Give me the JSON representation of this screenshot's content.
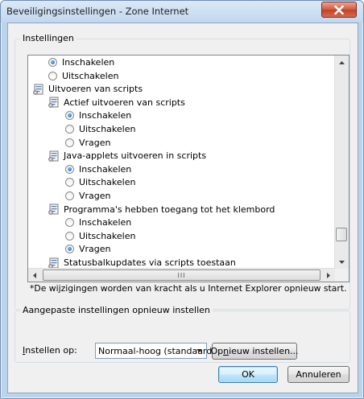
{
  "window": {
    "title": "Beveiligingsinstellingen - Zone Internet"
  },
  "settings_group": {
    "label": "Instellingen"
  },
  "settings_list": {
    "rows": [
      {
        "kind": "radio",
        "level": 1,
        "checked": true,
        "label": "Inschakelen"
      },
      {
        "kind": "radio",
        "level": 1,
        "checked": false,
        "label": "Uitschakelen"
      },
      {
        "kind": "header",
        "level": 0,
        "label": "Uitvoeren van scripts"
      },
      {
        "kind": "header",
        "level": 1,
        "label": "Actief uitvoeren van scripts"
      },
      {
        "kind": "radio",
        "level": 2,
        "checked": true,
        "label": "Inschakelen"
      },
      {
        "kind": "radio",
        "level": 2,
        "checked": false,
        "label": "Uitschakelen"
      },
      {
        "kind": "radio",
        "level": 2,
        "checked": false,
        "label": "Vragen"
      },
      {
        "kind": "header",
        "level": 1,
        "label": "Java-applets uitvoeren in scripts"
      },
      {
        "kind": "radio",
        "level": 2,
        "checked": true,
        "label": "Inschakelen"
      },
      {
        "kind": "radio",
        "level": 2,
        "checked": false,
        "label": "Uitschakelen"
      },
      {
        "kind": "radio",
        "level": 2,
        "checked": false,
        "label": "Vragen"
      },
      {
        "kind": "header",
        "level": 1,
        "label": "Programma's hebben toegang tot het klembord"
      },
      {
        "kind": "radio",
        "level": 2,
        "checked": false,
        "label": "Inschakelen"
      },
      {
        "kind": "radio",
        "level": 2,
        "checked": false,
        "label": "Uitschakelen"
      },
      {
        "kind": "radio",
        "level": 2,
        "checked": true,
        "label": "Vragen"
      },
      {
        "kind": "header",
        "level": 1,
        "label": "Statusbalkupdates via scripts toestaan"
      }
    ],
    "hscroll_grip": "III"
  },
  "note": "*De wijzigingen worden van kracht als u Internet Explorer opnieuw start.",
  "reset_group": {
    "label": "Aangepaste instellingen opnieuw instellen",
    "reset_to_label": "Instellen op:",
    "reset_to_label_accesskey": "I",
    "reset_to_label_rest": "nstellen op:",
    "level_value": "Normaal-hoog (standaard)",
    "reset_button": "Opnieuw instellen...",
    "reset_button_pre": "Op",
    "reset_button_accesskey": "n",
    "reset_button_post": "ieuw instellen..."
  },
  "footer": {
    "ok": "OK",
    "cancel": "Annuleren"
  },
  "colors": {
    "radio_checked": "#1b5ab0",
    "close_button": "#c24226"
  }
}
